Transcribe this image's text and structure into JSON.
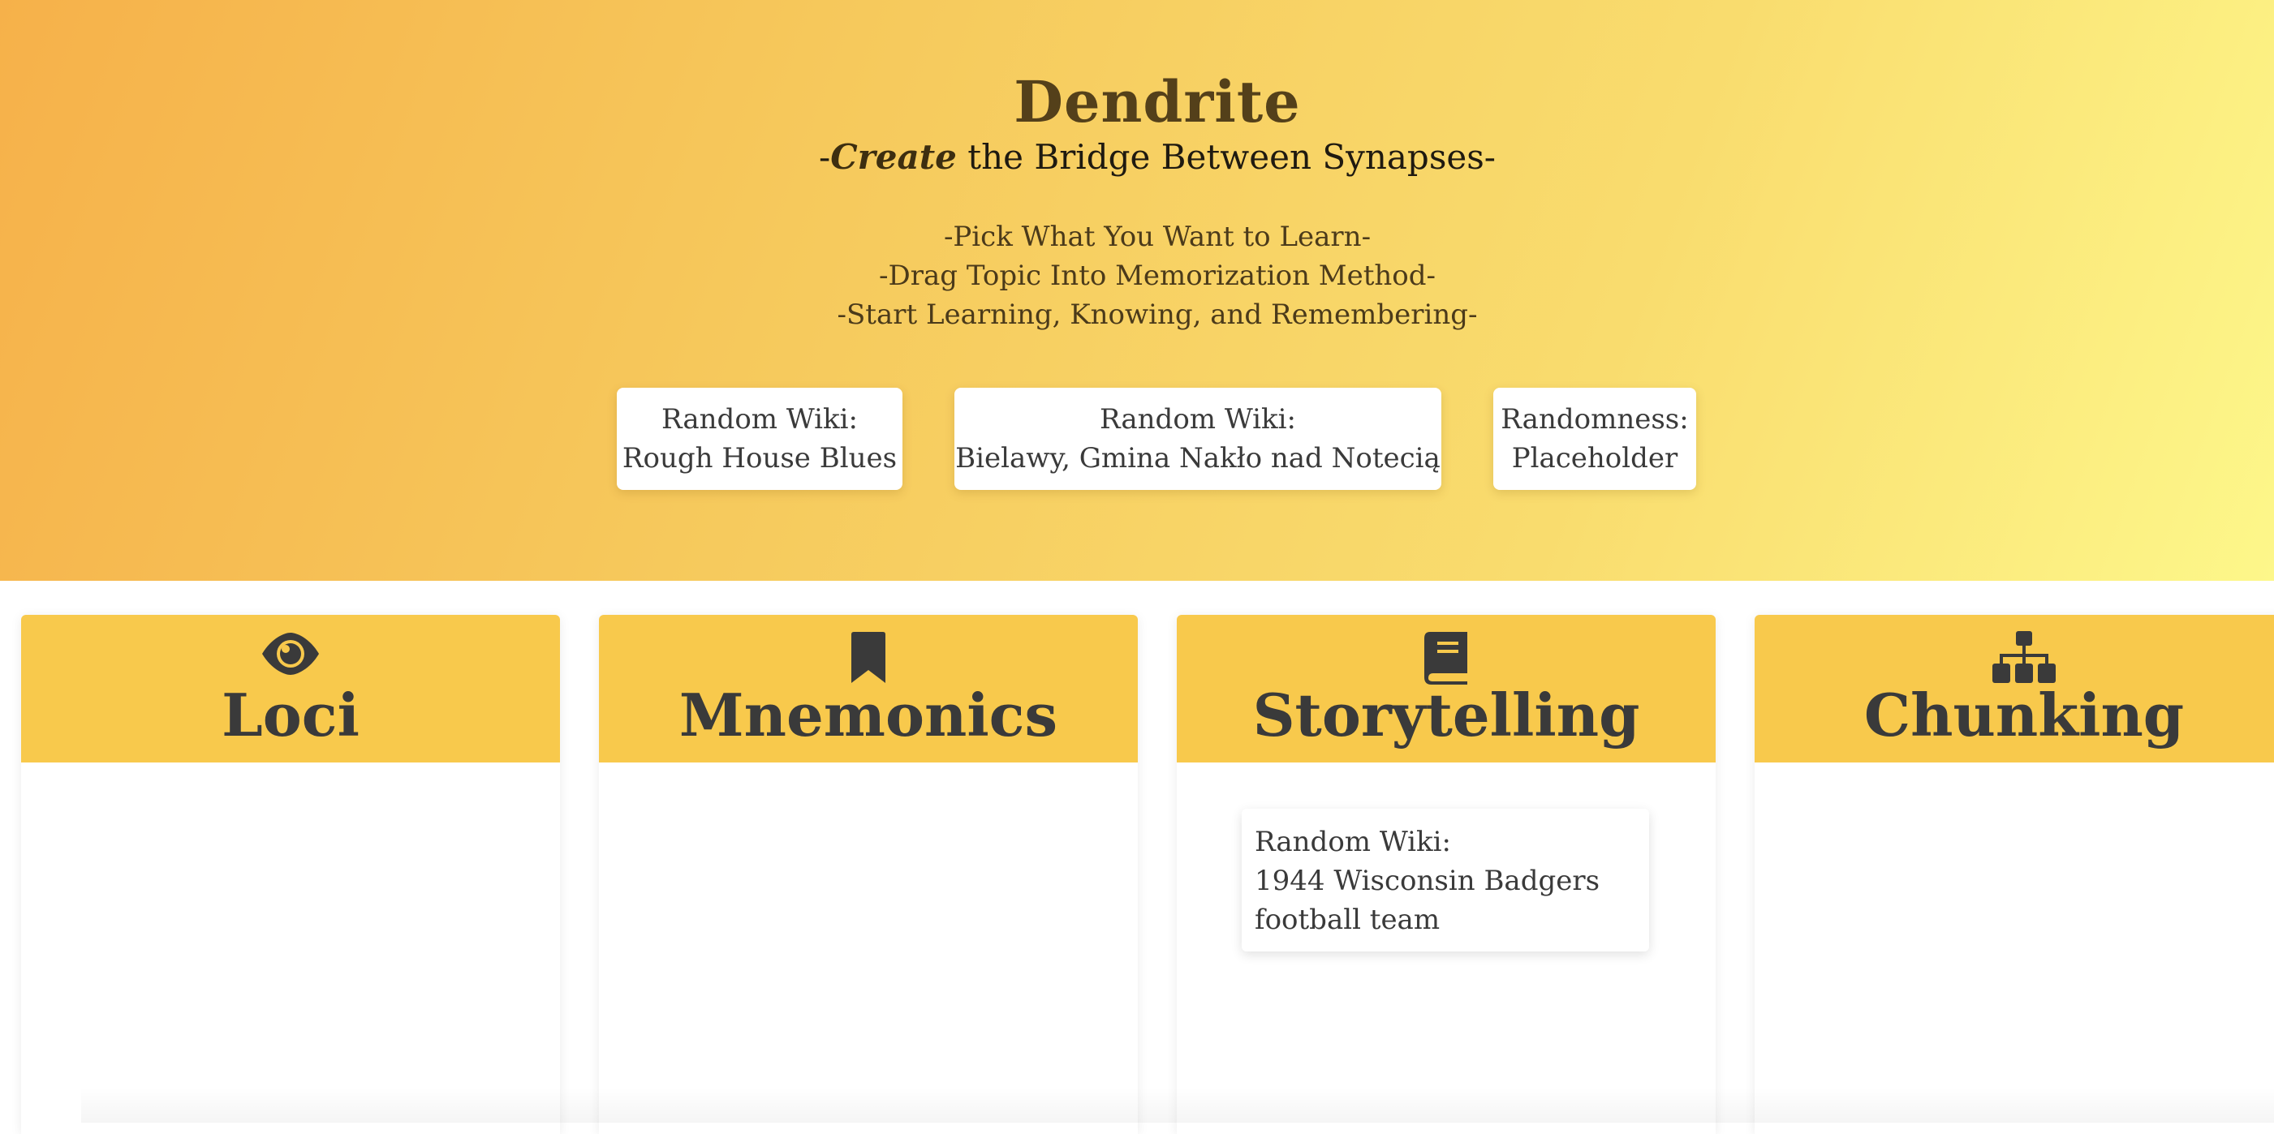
{
  "header": {
    "title": "Dendrite",
    "tagline_prefix": "-",
    "tagline_emphasis": "Create",
    "tagline_rest": " the Bridge Between Synapses-",
    "steps": [
      "-Pick What You Want to Learn-",
      "-Drag Topic Into Memorization Method-",
      "-Start Learning, Knowing, and Remembering-"
    ]
  },
  "topics": [
    {
      "label": "Random Wiki:",
      "value": "Rough House Blues"
    },
    {
      "label": "Random Wiki:",
      "value": "Bielawy, Gmina Nakło nad Notecią"
    },
    {
      "label": "Randomness:",
      "value": "Placeholder"
    }
  ],
  "methods": [
    {
      "title": "Loci",
      "icon": "eye-icon"
    },
    {
      "title": "Mnemonics",
      "icon": "bookmark-icon"
    },
    {
      "title": "Storytelling",
      "icon": "book-icon"
    },
    {
      "title": "Chunking",
      "icon": "sitemap-icon"
    }
  ],
  "dropped": {
    "column": "Storytelling",
    "label": "Random Wiki:",
    "value_line1": "1944 Wisconsin Badgers",
    "value_line2": "football team"
  },
  "colors": {
    "accent": "#f8c94c",
    "gradient_start": "#f6b14a",
    "gradient_end": "#fdf78a",
    "title_color": "#54401a"
  }
}
